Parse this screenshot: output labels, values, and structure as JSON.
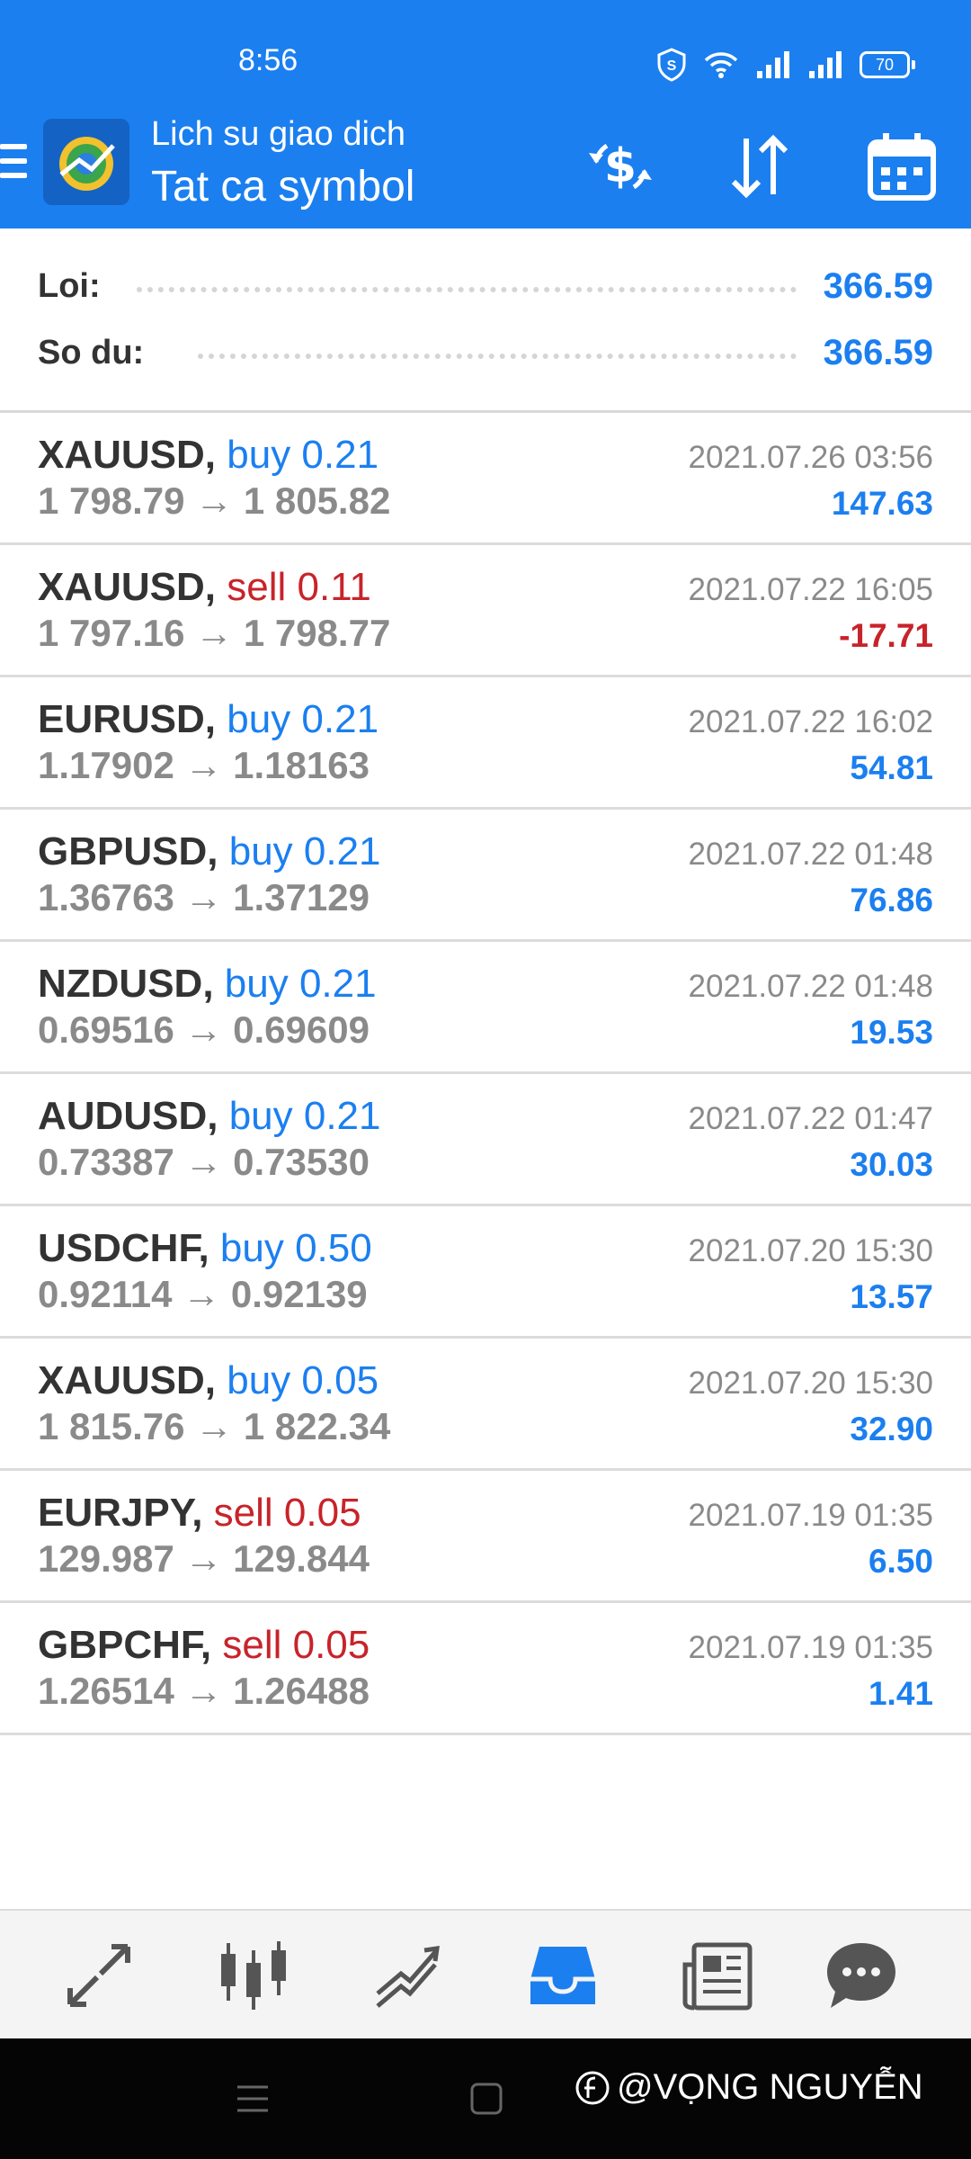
{
  "status_bar": {
    "time": "8:56",
    "battery": "70"
  },
  "appbar": {
    "subtitle": "Lich su giao dich",
    "title": "Tat ca symbol"
  },
  "summary": {
    "profit_label": "Loi:",
    "profit_value": "366.59",
    "balance_label": "So du:",
    "balance_value": "366.59"
  },
  "trades": [
    {
      "symbol": "XAUUSD,",
      "type": "buy 0.21",
      "side": "buy",
      "prices": "1 798.79 → 1 805.82",
      "time": "2021.07.26 03:56",
      "profit": "147.63"
    },
    {
      "symbol": "XAUUSD,",
      "type": "sell 0.11",
      "side": "sell",
      "prices": "1 797.16 → 1 798.77",
      "time": "2021.07.22 16:05",
      "profit": "-17.71"
    },
    {
      "symbol": "EURUSD,",
      "type": "buy 0.21",
      "side": "buy",
      "prices": "1.17902 → 1.18163",
      "time": "2021.07.22 16:02",
      "profit": "54.81"
    },
    {
      "symbol": "GBPUSD,",
      "type": "buy 0.21",
      "side": "buy",
      "prices": "1.36763 → 1.37129",
      "time": "2021.07.22 01:48",
      "profit": "76.86"
    },
    {
      "symbol": "NZDUSD,",
      "type": "buy 0.21",
      "side": "buy",
      "prices": "0.69516 → 0.69609",
      "time": "2021.07.22 01:48",
      "profit": "19.53"
    },
    {
      "symbol": "AUDUSD,",
      "type": "buy 0.21",
      "side": "buy",
      "prices": "0.73387 → 0.73530",
      "time": "2021.07.22 01:47",
      "profit": "30.03"
    },
    {
      "symbol": "USDCHF,",
      "type": "buy 0.50",
      "side": "buy",
      "prices": "0.92114 → 0.92139",
      "time": "2021.07.20 15:30",
      "profit": "13.57"
    },
    {
      "symbol": "XAUUSD,",
      "type": "buy 0.05",
      "side": "buy",
      "prices": "1 815.76 → 1 822.34",
      "time": "2021.07.20 15:30",
      "profit": "32.90"
    },
    {
      "symbol": "EURJPY,",
      "type": "sell 0.05",
      "side": "sell",
      "prices": "129.987 → 129.844",
      "time": "2021.07.19 01:35",
      "profit": "6.50"
    },
    {
      "symbol": "GBPCHF,",
      "type": "sell 0.05",
      "side": "sell",
      "prices": "1.26514 → 1.26488",
      "time": "2021.07.19 01:35",
      "profit": "1.41"
    }
  ],
  "bottom_nav": [
    {
      "icon": "quotes-icon",
      "active": false
    },
    {
      "icon": "chart-icon",
      "active": false
    },
    {
      "icon": "trade-icon",
      "active": false
    },
    {
      "icon": "history-icon",
      "active": true
    },
    {
      "icon": "news-icon",
      "active": false
    },
    {
      "icon": "chat-icon",
      "active": false
    }
  ],
  "watermark": "@VỌNG NGUYỄN",
  "colors": {
    "accent": "#1b7ff0",
    "sell": "#c8232a",
    "muted": "#8a8a8a"
  }
}
